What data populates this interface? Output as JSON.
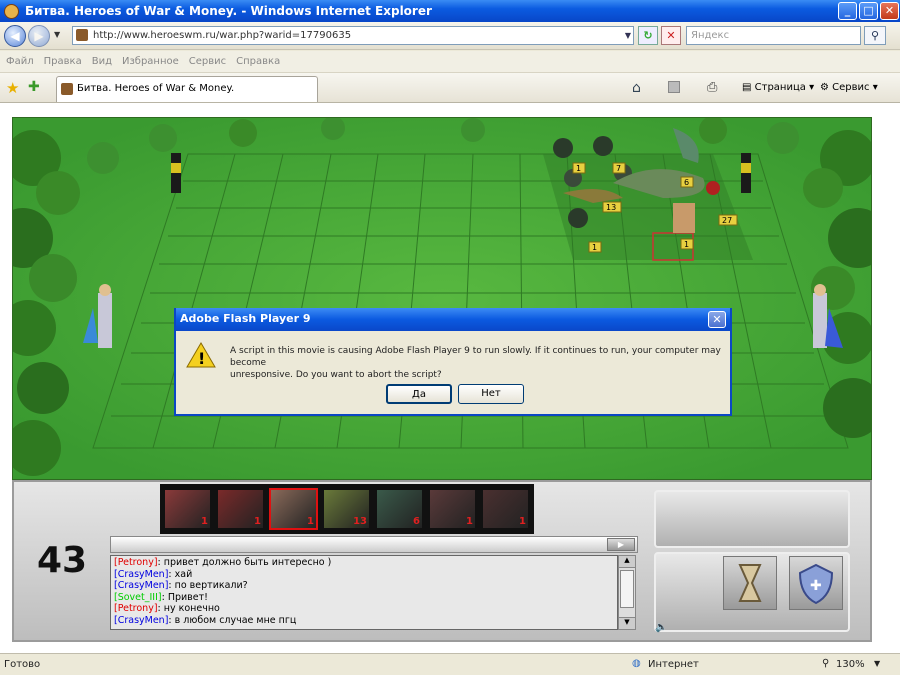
{
  "window": {
    "title": "Битва. Heroes of War & Money. - Windows Internet Explorer"
  },
  "address": {
    "url": "http://www.heroeswm.ru/war.php?warid=17790635",
    "search_placeholder": "Яндекс"
  },
  "menu": [
    "Файл",
    "Правка",
    "Вид",
    "Избранное",
    "Сервис",
    "Справка"
  ],
  "tab": {
    "label": "Битва. Heroes of War & Money."
  },
  "commandbar": {
    "page_label": "Страница",
    "service_label": "Сервис"
  },
  "dialog": {
    "title": "Adobe Flash Player 9",
    "message_line1": "A script in this movie is causing Adobe Flash Player 9 to run slowly.  If it continues to run, your computer may become",
    "message_line2": "unresponsive.  Do you want to abort the script?",
    "yes_label": "Да",
    "no_label": "Нет"
  },
  "game": {
    "turn_counter": "43",
    "unit_badges": [
      "1",
      "7",
      "6",
      "13",
      "27",
      "1",
      "1"
    ],
    "queue": [
      {
        "count": "1",
        "color": "#8a3a3a"
      },
      {
        "count": "1",
        "color": "#7a2a2a"
      },
      {
        "count": "1",
        "color": "#8a6a5a"
      },
      {
        "count": "13",
        "color": "#6a7a3a"
      },
      {
        "count": "6",
        "color": "#3a5a4a"
      },
      {
        "count": "1",
        "color": "#5a3a3a"
      },
      {
        "count": "1",
        "color": "#4a3030"
      }
    ],
    "chat": [
      {
        "name": "[Petrony]",
        "name_color": "#e00000",
        "text": ": привет  должно быть интересно )"
      },
      {
        "name": "[CrasyMen]",
        "name_color": "#0000e0",
        "text": ": хай"
      },
      {
        "name": "[CrasyMen]",
        "name_color": "#0000e0",
        "text": ": по вертикали?"
      },
      {
        "name": "[Sovet_III]",
        "name_color": "#00cc00",
        "text": ": Привет!"
      },
      {
        "name": "[Petrony]",
        "name_color": "#e00000",
        "text": ": ну конечно"
      },
      {
        "name": "[CrasyMen]",
        "name_color": "#0000e0",
        "text": ": в любом случае мне пгц"
      }
    ]
  },
  "status": {
    "left": "Готово",
    "zone": "Интернет",
    "zoom": "130%"
  }
}
